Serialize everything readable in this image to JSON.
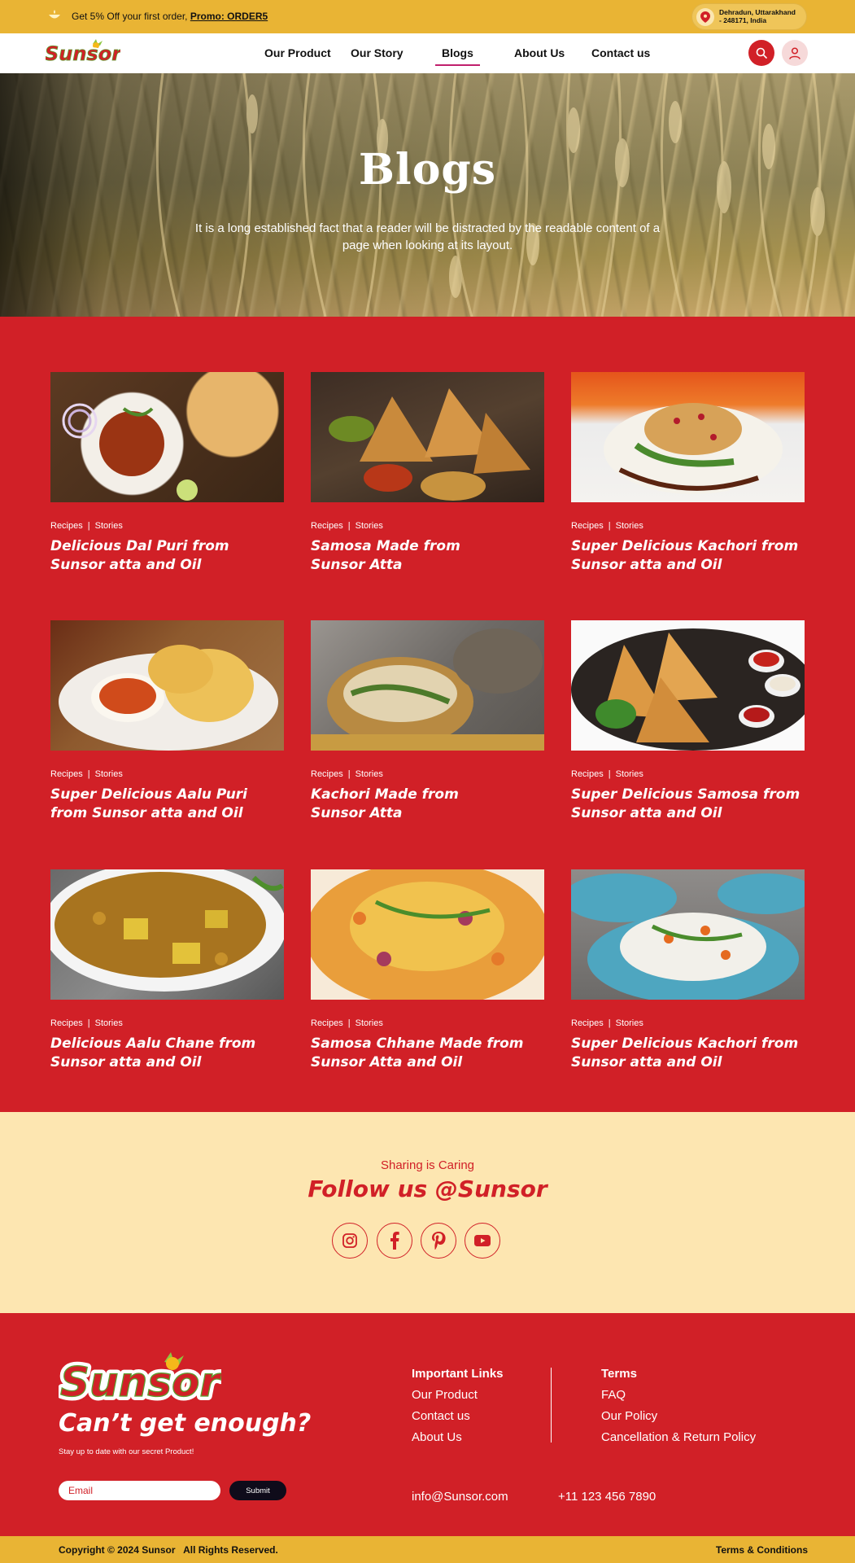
{
  "promo": {
    "text": "Get 5% Off your first order, ",
    "code": "Promo: ORDER5",
    "location_line1": "Dehradun, Uttarakhand",
    "location_line2": "- 248171, India"
  },
  "brand": {
    "name": "Sunsor"
  },
  "nav": {
    "items": [
      {
        "label": "Our Product"
      },
      {
        "label": "Our Story"
      },
      {
        "label": "Blogs"
      },
      {
        "label": "About Us"
      },
      {
        "label": "Contact us"
      }
    ],
    "active": "Blogs"
  },
  "hero": {
    "title": "Blogs",
    "subtitle": "It is a long established fact that a reader will be distracted by the readable content of a page when looking at its layout."
  },
  "blog_meta": {
    "cat1": "Recipes",
    "sep": "|",
    "cat2": "Stories"
  },
  "blogs": [
    {
      "title": "Delicious Dal Puri from Sunsor atta and Oil",
      "image": "dal-puri-photo"
    },
    {
      "title": "Samosa Made from Sunsor Atta",
      "image": "samosa-photo"
    },
    {
      "title": "Super Delicious Kachori from Sunsor atta and Oil",
      "image": "dahi-kachori-photo"
    },
    {
      "title": "Super Delicious Aalu Puri from Sunsor atta and Oil",
      "image": "aalu-puri-photo"
    },
    {
      "title": "Kachori Made from Sunsor Atta",
      "image": "kachori-photo"
    },
    {
      "title": "Super Delicious Samosa from Sunsor atta and Oil",
      "image": "samosa-plate-photo"
    },
    {
      "title": "Delicious Aalu Chane from Sunsor atta and Oil",
      "image": "aalu-chane-photo"
    },
    {
      "title": "Samosa Chhane Made from Sunsor Atta and Oil",
      "image": "samosa-chaat-photo"
    },
    {
      "title": "Super Delicious Kachori from Sunsor atta and Oil",
      "image": "dahi-puri-photo"
    }
  ],
  "follow": {
    "kicker": "Sharing is Caring",
    "title": "Follow us @Sunsor",
    "socials": [
      "instagram-icon",
      "facebook-icon",
      "pinterest-icon",
      "youtube-icon"
    ]
  },
  "footer": {
    "tagline": "Can’t get enough?",
    "small": "Stay up to date with our secret Product!",
    "email_placeholder": "Email",
    "submit": "Submit",
    "important_head": "Important Links",
    "important_links": [
      "Our Product",
      "Contact us",
      "About Us"
    ],
    "terms_head": "Terms",
    "terms_links": [
      "FAQ",
      "Our Policy",
      "Cancellation & Return Policy"
    ],
    "email": "info@Sunsor.com",
    "phone": "+11 123 456 7890",
    "copyright": "Copyright © 2024 Sunsor   All Rights Reserved.",
    "terms_conditions": "Terms & Conditions"
  },
  "colors": {
    "brand_red": "#d12027",
    "brand_yellow": "#e9b434",
    "cream": "#fde6b1"
  }
}
